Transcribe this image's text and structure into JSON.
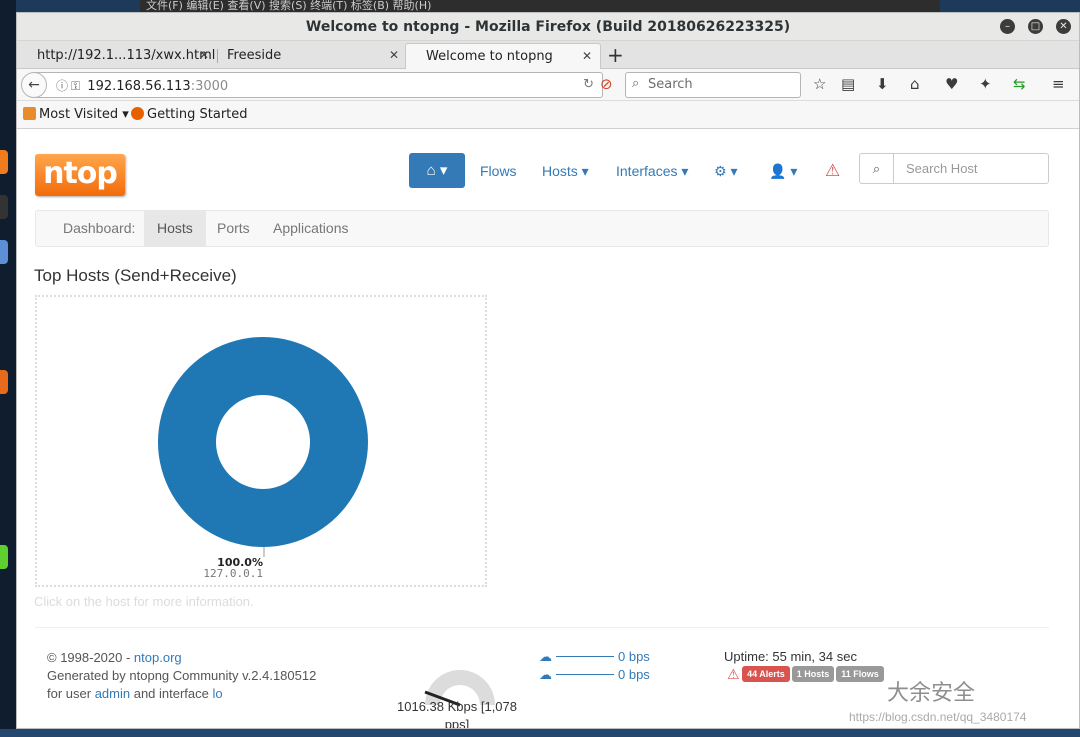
{
  "desktop": {
    "menu_text": "文件(F)   编辑(E)   查看(V)   搜索(S)   终端(T)   标签(B)   帮助(H)"
  },
  "window": {
    "title": "Welcome to ntopng - Mozilla Firefox (Build 20180626223325)",
    "tabs": [
      {
        "label": "http://192.1...113/xwx.html"
      },
      {
        "label": "Freeside"
      },
      {
        "label": "Welcome to ntopng"
      }
    ],
    "new_tab": "+",
    "url_host": "192.168.56.113",
    "url_port": ":3000",
    "search_placeholder": "Search",
    "bookmarks": [
      "Most Visited",
      "Getting Started"
    ]
  },
  "app": {
    "logo_text": "ntop",
    "nav": {
      "flows": "Flows",
      "hosts": "Hosts",
      "interfaces": "Interfaces"
    },
    "search_host_placeholder": "Search Host",
    "subnav": {
      "label": "Dashboard:",
      "items": [
        "Hosts",
        "Ports",
        "Applications"
      ],
      "active": "Hosts"
    },
    "section_title": "Top Hosts (Send+Receive)",
    "hint": "Click on the host for more information.",
    "footer": {
      "copyright": "© 1998-2020 - ",
      "copyright_link": "ntop.org",
      "generated": "Generated by ntopng Community v.2.4.180512",
      "user_prefix": "for user ",
      "user": "admin",
      "iface_prefix": " and interface ",
      "iface": "lo",
      "throughput": "1016.38 Kbps [1,078 pps]",
      "upload_bps": "0 bps",
      "download_bps": "0 bps",
      "uptime": "Uptime: 55 min, 34 sec",
      "alerts_badge": "44 Alerts",
      "hosts_badge": "1 Hosts",
      "flows_badge": "11 Flows"
    },
    "colors": {
      "accent": "#337ab7",
      "donut": "#1f77b4",
      "alert": "#d9534f",
      "badge_gray": "#999999"
    }
  },
  "watermark": {
    "text": "大余安全",
    "url": "https://blog.csdn.net/qq_3480174"
  },
  "chart_data": {
    "type": "pie",
    "title": "Top Hosts (Send+Receive)",
    "categories": [
      "127.0.0.1"
    ],
    "values": [
      100.0
    ],
    "labels": [
      "100.0%"
    ]
  }
}
